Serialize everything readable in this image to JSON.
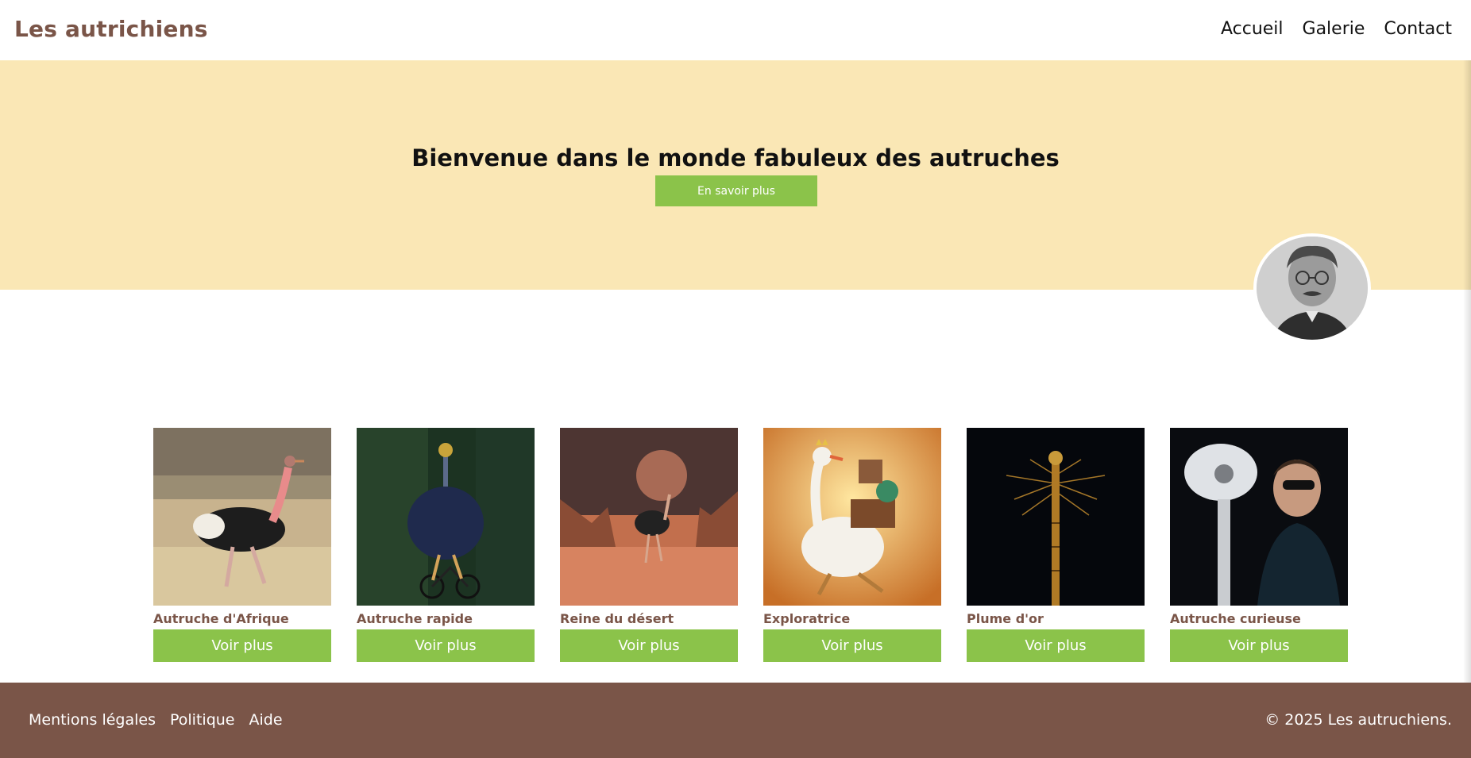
{
  "header": {
    "brand": "Les autrichiens",
    "nav": [
      "Accueil",
      "Galerie",
      "Contact"
    ]
  },
  "hero": {
    "title": "Bienvenue dans le monde fabuleux des autruches",
    "button": "En savoir plus"
  },
  "gallery": [
    {
      "title": "Autruche d'Afrique",
      "button": "Voir plus"
    },
    {
      "title": "Autruche rapide",
      "button": "Voir plus"
    },
    {
      "title": "Reine du désert",
      "button": "Voir plus"
    },
    {
      "title": "Exploratrice",
      "button": "Voir plus"
    },
    {
      "title": "Plume d'or",
      "button": "Voir plus"
    },
    {
      "title": "Autruche curieuse",
      "button": "Voir plus"
    }
  ],
  "footer": {
    "links": [
      "Mentions légales",
      "Politique",
      "Aide"
    ],
    "copyright": "© 2025 Les autruchiens."
  },
  "colors": {
    "brand": "#7a5548",
    "hero_bg": "#fae7b5",
    "accent_green": "#8bc34a",
    "footer_bg": "#7a5548"
  }
}
